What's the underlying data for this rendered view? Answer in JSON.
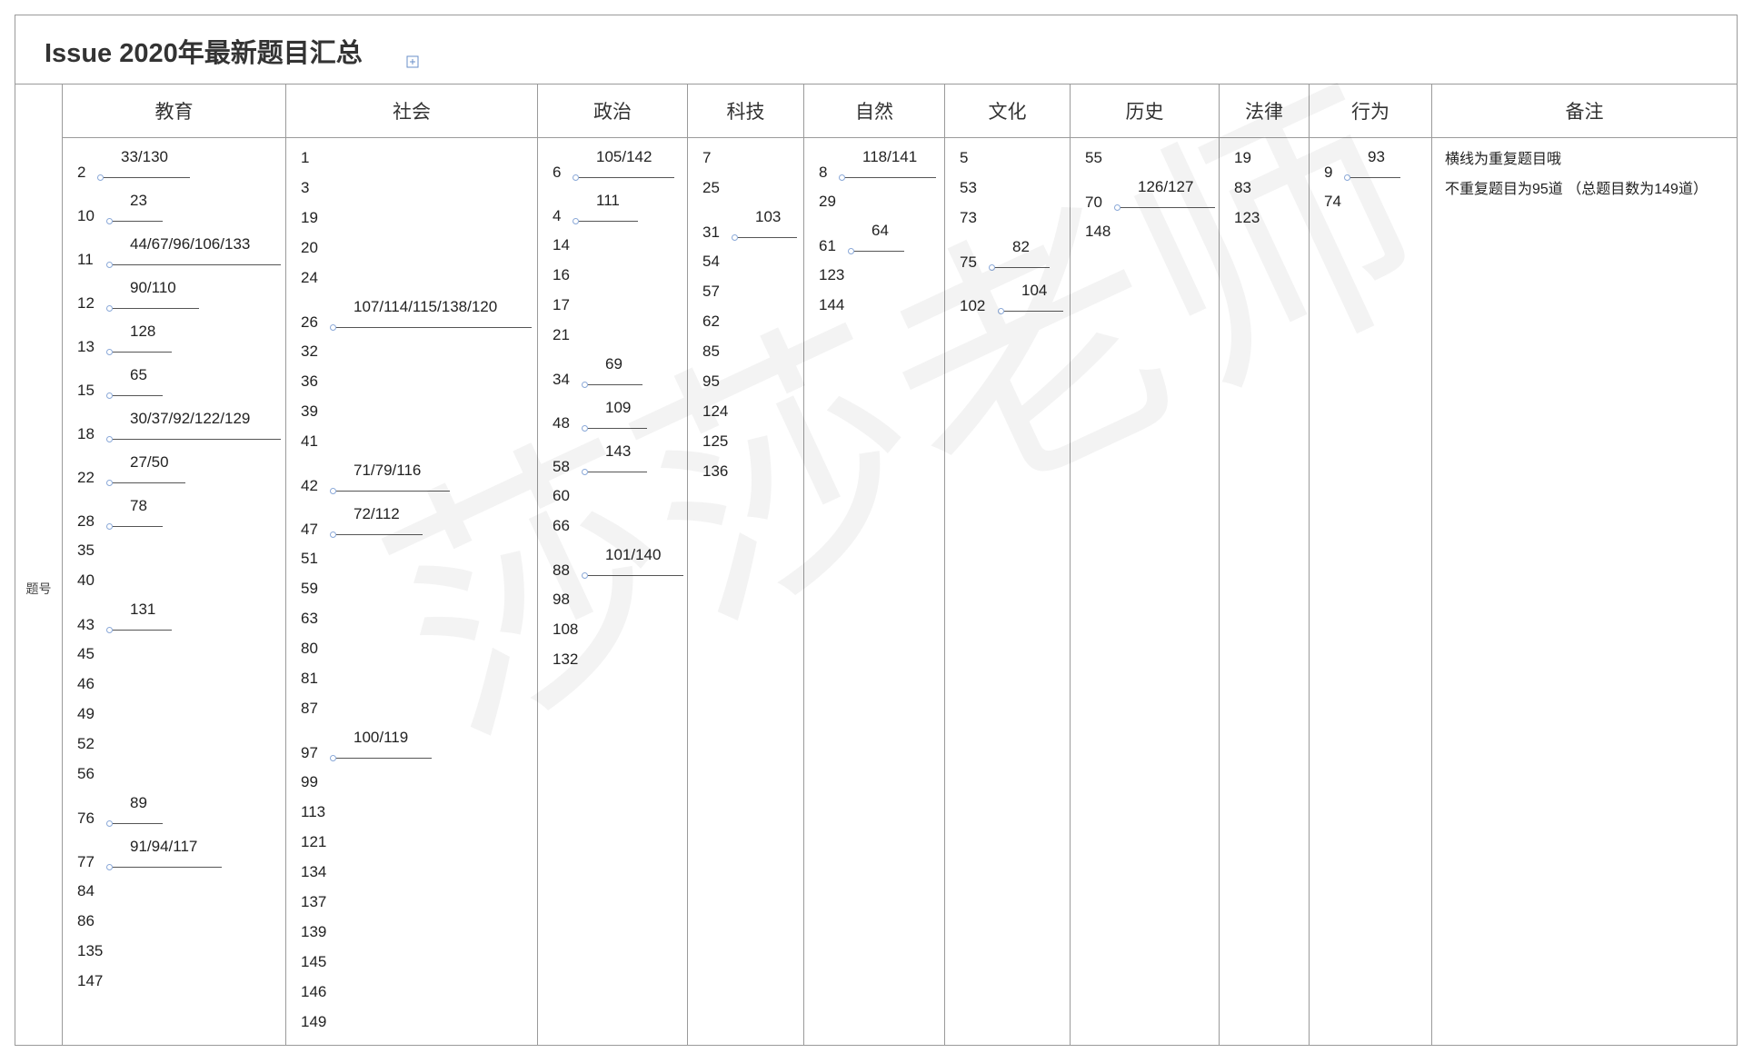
{
  "title": "Issue 2020年最新题目汇总",
  "row_label": "题号",
  "watermark": "莎莎老师",
  "categories": [
    {
      "name": "教育",
      "items": [
        {
          "n": "2",
          "dup": "33/130"
        },
        {
          "n": "10",
          "dup": "23"
        },
        {
          "n": "11",
          "dup": "44/67/96/106/133"
        },
        {
          "n": "12",
          "dup": "90/110"
        },
        {
          "n": "13",
          "dup": "128"
        },
        {
          "n": "15",
          "dup": "65"
        },
        {
          "n": "18",
          "dup": "30/37/92/122/129"
        },
        {
          "n": "22",
          "dup": "27/50"
        },
        {
          "n": "28",
          "dup": "78"
        },
        {
          "n": "35"
        },
        {
          "n": "40"
        },
        {
          "n": "43",
          "dup": "131"
        },
        {
          "n": "45"
        },
        {
          "n": "46"
        },
        {
          "n": "49"
        },
        {
          "n": "52"
        },
        {
          "n": "56"
        },
        {
          "n": "76",
          "dup": "89"
        },
        {
          "n": "77",
          "dup": "91/94/117"
        },
        {
          "n": "84"
        },
        {
          "n": "86"
        },
        {
          "n": "135"
        },
        {
          "n": "147"
        }
      ]
    },
    {
      "name": "社会",
      "items": [
        {
          "n": "1"
        },
        {
          "n": "3"
        },
        {
          "n": "19"
        },
        {
          "n": "20"
        },
        {
          "n": "24"
        },
        {
          "n": "26",
          "dup": "107/114/115/138/120"
        },
        {
          "n": "32"
        },
        {
          "n": "36"
        },
        {
          "n": "39"
        },
        {
          "n": "41"
        },
        {
          "n": "42",
          "dup": "71/79/116"
        },
        {
          "n": "47",
          "dup": "72/112"
        },
        {
          "n": "51"
        },
        {
          "n": "59"
        },
        {
          "n": "63"
        },
        {
          "n": "80"
        },
        {
          "n": "81"
        },
        {
          "n": "87"
        },
        {
          "n": "97",
          "dup": "100/119"
        },
        {
          "n": "99"
        },
        {
          "n": "113"
        },
        {
          "n": "121"
        },
        {
          "n": "134"
        },
        {
          "n": "137"
        },
        {
          "n": "139"
        },
        {
          "n": "145"
        },
        {
          "n": "146"
        },
        {
          "n": "149"
        }
      ]
    },
    {
      "name": "政治",
      "items": [
        {
          "n": "6",
          "dup": "105/142"
        },
        {
          "n": "4",
          "dup": "111"
        },
        {
          "n": "14"
        },
        {
          "n": "16"
        },
        {
          "n": "17"
        },
        {
          "n": "21"
        },
        {
          "n": "34",
          "dup": "69"
        },
        {
          "n": "48",
          "dup": "109"
        },
        {
          "n": "58",
          "dup": "143"
        },
        {
          "n": "60"
        },
        {
          "n": "66"
        },
        {
          "n": "88",
          "dup": "101/140"
        },
        {
          "n": "98"
        },
        {
          "n": "108"
        },
        {
          "n": "132"
        }
      ]
    },
    {
      "name": "科技",
      "items": [
        {
          "n": "7"
        },
        {
          "n": "25"
        },
        {
          "n": "31",
          "dup": "103"
        },
        {
          "n": "54"
        },
        {
          "n": "57"
        },
        {
          "n": "62"
        },
        {
          "n": "85"
        },
        {
          "n": "95"
        },
        {
          "n": "124"
        },
        {
          "n": "125"
        },
        {
          "n": "136"
        }
      ]
    },
    {
      "name": "自然",
      "items": [
        {
          "n": "8",
          "dup": "118/141"
        },
        {
          "n": "29"
        },
        {
          "n": "61",
          "dup": "64"
        },
        {
          "n": "123"
        },
        {
          "n": "144"
        }
      ]
    },
    {
      "name": "文化",
      "items": [
        {
          "n": "5"
        },
        {
          "n": "53"
        },
        {
          "n": "73"
        },
        {
          "n": "75",
          "dup": "82"
        },
        {
          "n": "102",
          "dup": "104"
        }
      ]
    },
    {
      "name": "历史",
      "items": [
        {
          "n": "55"
        },
        {
          "n": "70",
          "dup": "126/127"
        },
        {
          "n": "148"
        }
      ]
    },
    {
      "name": "法律",
      "items": [
        {
          "n": "19"
        },
        {
          "n": "83"
        },
        {
          "n": "123"
        }
      ]
    },
    {
      "name": "行为",
      "items": [
        {
          "n": "9",
          "dup": "93"
        },
        {
          "n": "74"
        }
      ]
    }
  ],
  "notes": {
    "header": "备注",
    "lines": [
      "横线为重复题目哦",
      "不重复题目为95道 （总题目数为149道）"
    ]
  }
}
